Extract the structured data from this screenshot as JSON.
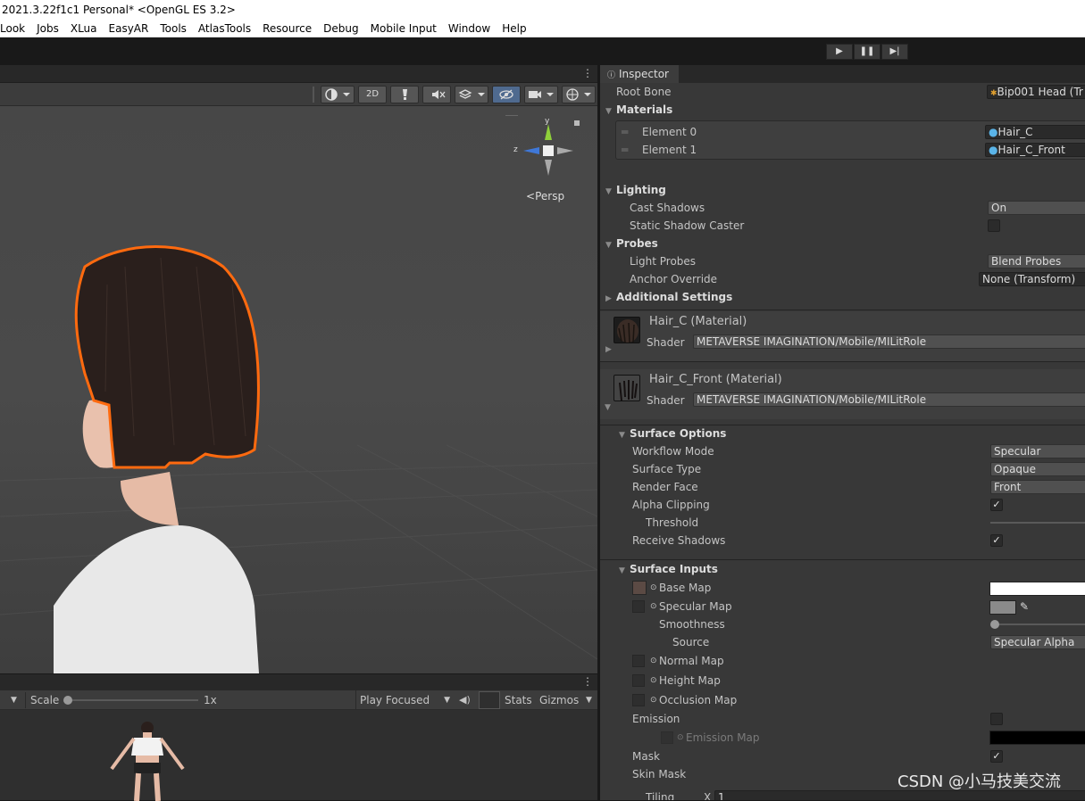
{
  "window": {
    "title": "2021.3.22f1c1 Personal* <OpenGL ES 3.2>"
  },
  "menu": [
    "Look",
    "Jobs",
    "XLua",
    "EasyAR",
    "Tools",
    "AtlasTools",
    "Resource",
    "Debug",
    "Mobile Input",
    "Window",
    "Help"
  ],
  "playbar": {
    "play": "▶",
    "pause": "❚❚",
    "step": "▶|"
  },
  "scene": {
    "tab_menu": "⋮",
    "btn_2d": "2D",
    "persp_label": "Persp",
    "axis_y": "y",
    "axis_z": "z"
  },
  "game": {
    "tab_menu": "⋮",
    "scale_label": "Scale",
    "scale_value": "1x",
    "play_focused": "Play Focused",
    "stats": "Stats",
    "gizmos": "Gizmos"
  },
  "inspector": {
    "tab_label": "Inspector",
    "tab_menu": "⋮",
    "root_bone": {
      "label": "Root Bone",
      "value": "Bip001 Head (Tr"
    },
    "materials": {
      "header": "Materials",
      "element0": {
        "label": "Element 0",
        "value": "Hair_C"
      },
      "element1": {
        "label": "Element 1",
        "value": "Hair_C_Front"
      }
    },
    "lighting": {
      "header": "Lighting",
      "cast_shadows": {
        "label": "Cast Shadows",
        "value": "On"
      },
      "static_shadow": {
        "label": "Static Shadow Caster"
      }
    },
    "probes": {
      "header": "Probes",
      "light_probes": {
        "label": "Light Probes",
        "value": "Blend Probes"
      },
      "anchor_override": {
        "label": "Anchor Override",
        "value": "None (Transform)"
      }
    },
    "additional": {
      "header": "Additional Settings"
    },
    "mat1": {
      "title": "Hair_C (Material)",
      "shader_label": "Shader",
      "shader": "METAVERSE IMAGINATION/Mobile/MILitRole"
    },
    "mat2": {
      "title": "Hair_C_Front (Material)",
      "shader_label": "Shader",
      "shader": "METAVERSE IMAGINATION/Mobile/MILitRole"
    },
    "surface_options": {
      "header": "Surface Options",
      "workflow": {
        "label": "Workflow Mode",
        "value": "Specular"
      },
      "surface_type": {
        "label": "Surface Type",
        "value": "Opaque"
      },
      "render_face": {
        "label": "Render Face",
        "value": "Front"
      },
      "alpha_clipping": {
        "label": "Alpha Clipping",
        "checked": "✓"
      },
      "threshold": {
        "label": "Threshold"
      },
      "receive_shadows": {
        "label": "Receive Shadows",
        "checked": "✓"
      }
    },
    "surface_inputs": {
      "header": "Surface Inputs",
      "base_map": "Base Map",
      "specular_map": "Specular Map",
      "smoothness": "Smoothness",
      "source": {
        "label": "Source",
        "value": "Specular Alpha"
      },
      "normal_map": "Normal Map",
      "height_map": "Height Map",
      "occlusion_map": "Occlusion Map",
      "emission": "Emission",
      "emission_map": "Emission Map",
      "mask": {
        "label": "Mask",
        "checked": "✓"
      },
      "skin_mask": "Skin Mask",
      "tiling": "Tiling",
      "tiling_x": "X",
      "tiling_x_value": "1"
    }
  },
  "watermark": "CSDN @小马技美交流"
}
